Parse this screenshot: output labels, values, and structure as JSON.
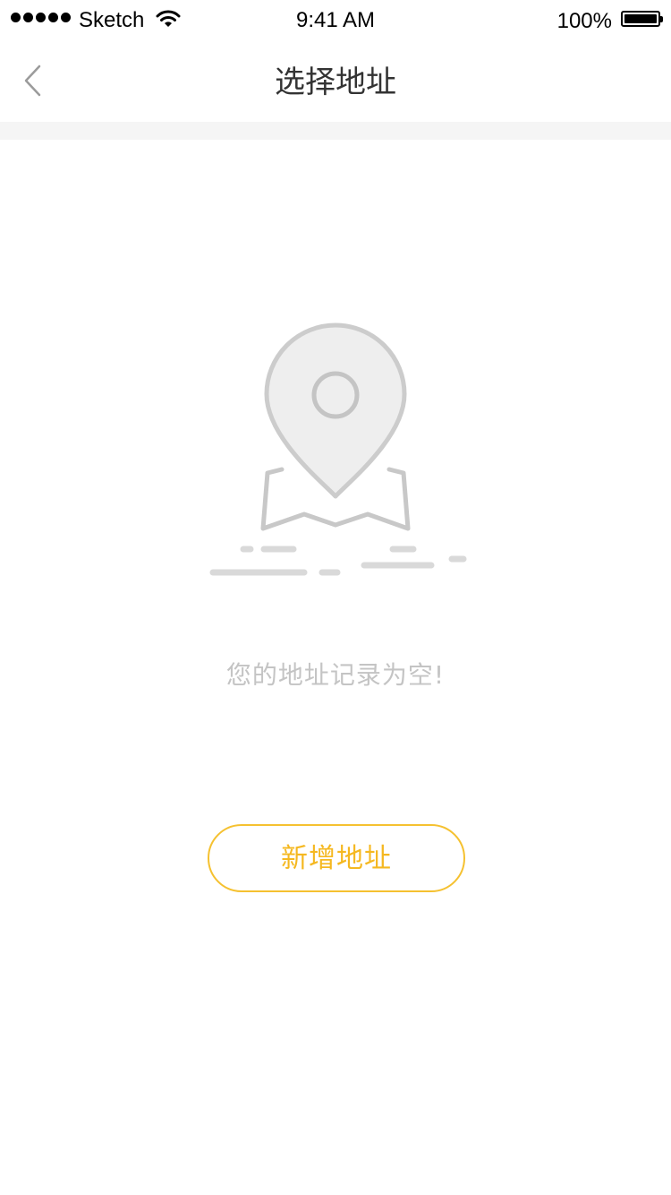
{
  "status_bar": {
    "carrier": "Sketch",
    "time": "9:41 AM",
    "battery_percent": "100%"
  },
  "nav": {
    "title": "选择地址",
    "back_icon": "chevron-left-icon"
  },
  "empty_state": {
    "illustration_icon": "map-pin-icon",
    "message": "您的地址记录为空!"
  },
  "actions": {
    "add_address_label": "新增地址"
  },
  "colors": {
    "accent": "#f5c130",
    "muted_text": "#c4c4c4",
    "illustration_stroke": "#c8c8c8",
    "illustration_fill": "#eeeeee",
    "divider": "#f5f5f5"
  }
}
